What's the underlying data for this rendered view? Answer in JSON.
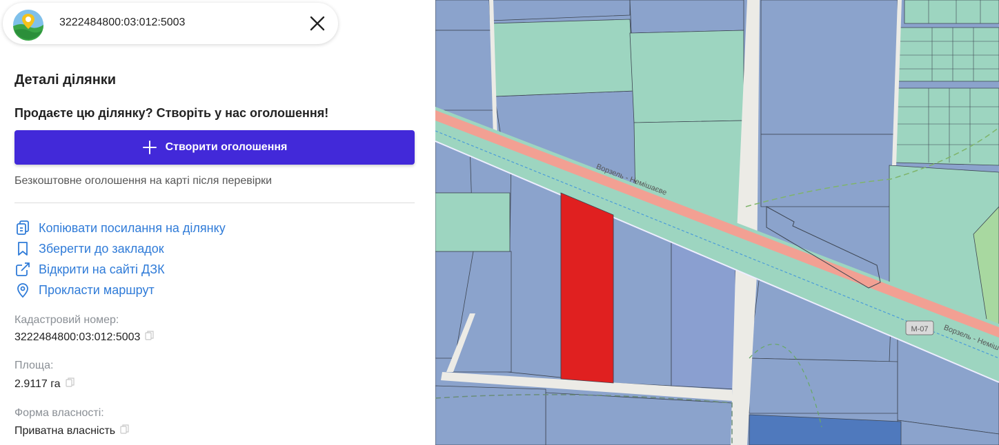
{
  "search": {
    "value": "3222484800:03:012:5003"
  },
  "details": {
    "title": "Деталі ділянки",
    "promo": "Продаєте цю ділянку? Створіть у нас оголошення!",
    "create_button": "Створити оголошення",
    "free_note": "Безкоштовне оголошення на карті після перевірки"
  },
  "actions": [
    {
      "label": "Копіювати посилання на ділянку",
      "icon": "copy-link-icon"
    },
    {
      "label": "Зберегти до закладок",
      "icon": "bookmark-icon"
    },
    {
      "label": "Відкрити на сайті ДЗК",
      "icon": "external-link-icon"
    },
    {
      "label": "Прокласти маршрут",
      "icon": "location-pin-icon"
    }
  ],
  "fields": {
    "cadastral_label": "Кадастровий номер:",
    "cadastral_value": "3222484800:03:012:5003",
    "area_label": "Площа:",
    "area_value": "2.9117 га",
    "ownership_label": "Форма власності:",
    "ownership_value": "Приватна власність"
  },
  "map": {
    "road_label_1": "Ворзель - Немішаєве",
    "road_label_2": "Ворзель - Неміш",
    "highway_shield": "М-07"
  },
  "colors": {
    "accent": "#4229d9",
    "link": "#2f7bd8",
    "selected_parcel": "#e02020",
    "parcel_blue": "#8ba3cc",
    "parcel_green": "#9dd5c0"
  }
}
